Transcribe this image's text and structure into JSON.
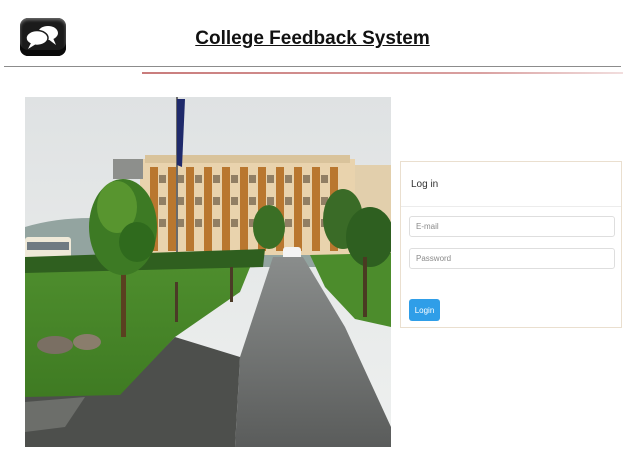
{
  "header": {
    "title": "College Feedback System",
    "logo_icon": "speech-bubbles-icon"
  },
  "login": {
    "heading": "Log in",
    "email_placeholder": "E-mail",
    "password_placeholder": "Password",
    "button_label": "Login"
  },
  "colors": {
    "header_rule": "#8c8c8c",
    "accent_rule": "#c97c7c",
    "button": "#2f9ee8",
    "panel_border": "#eadfcf"
  }
}
